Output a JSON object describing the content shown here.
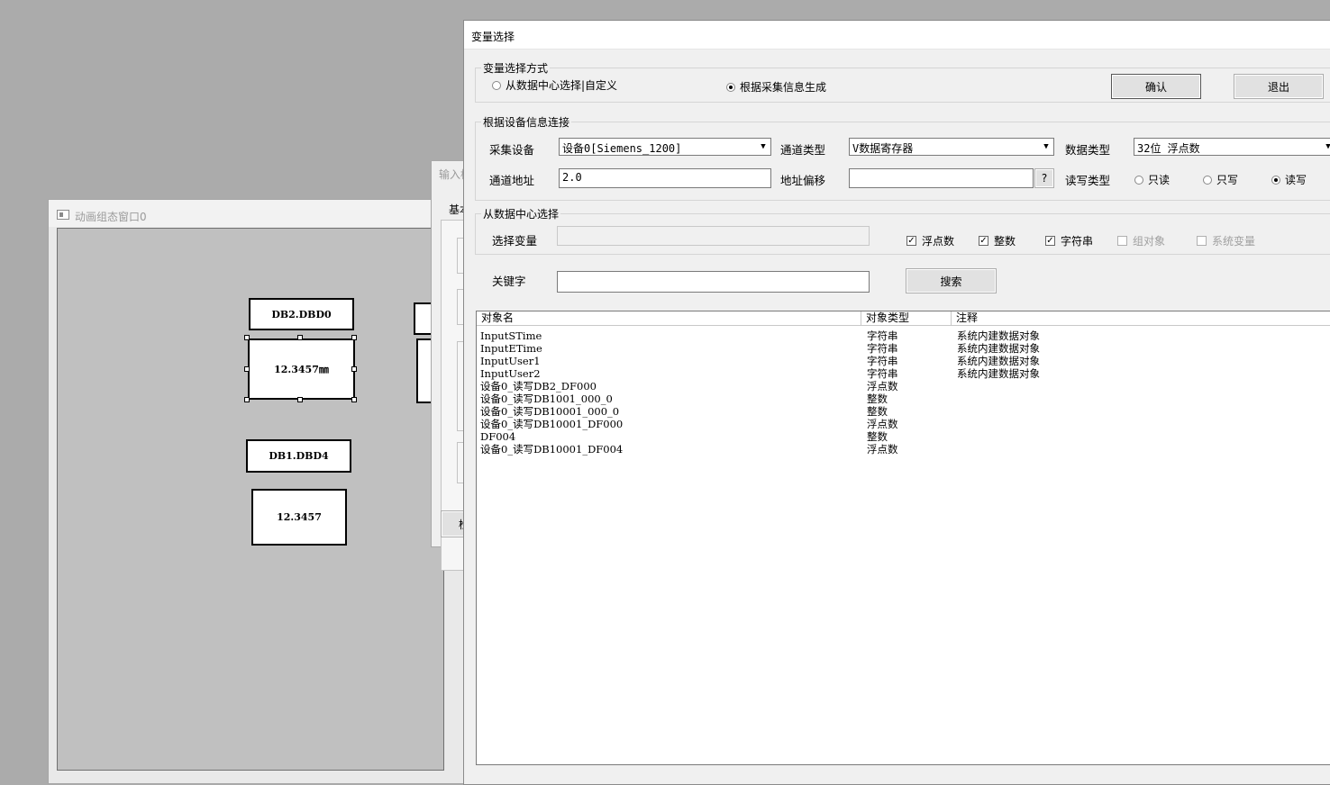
{
  "anim_window": {
    "title": "动画组态窗口0",
    "labels": [
      "DB2.DBD0",
      "DB1.DBD4"
    ],
    "values": [
      "12.3457㎜",
      "12.3457"
    ]
  },
  "mid_dialog": {
    "title": "输入框",
    "tab": "基本",
    "bottom_button": "检"
  },
  "dialog": {
    "title": "变量选择",
    "mode_group": {
      "legend": "变量选择方式",
      "opt_datacenter": "从数据中心选择|自定义",
      "opt_collect": "根据采集信息生成",
      "selected": "根据采集信息生成"
    },
    "confirm_label": "确认",
    "exit_label": "退出",
    "device_group": {
      "legend": "根据设备信息连接",
      "device_label": "采集设备",
      "device_value": "设备0[Siemens_1200]",
      "channel_type_label": "通道类型",
      "channel_type_value": "V数据寄存器",
      "data_type_label": "数据类型",
      "data_type_value": "32位 浮点数",
      "address_label": "通道地址",
      "address_value": "2.0",
      "offset_label": "地址偏移",
      "offset_value": "",
      "offset_btn": "?",
      "rw_label": "读写类型",
      "rw_readonly": "只读",
      "rw_writeonly": "只写",
      "rw_readwrite": "读写",
      "rw_selected": "读写"
    },
    "datacenter_group": {
      "legend": "从数据中心选择",
      "select_label": "选择变量",
      "select_value": "",
      "chk_float": "浮点数",
      "chk_int": "整数",
      "chk_string": "字符串",
      "chk_group": "组对象",
      "chk_system": "系统变量"
    },
    "keyword_label": "关键字",
    "keyword_value": "",
    "search_label": "搜索",
    "table": {
      "headers": [
        "对象名",
        "对象类型",
        "注释"
      ],
      "rows": [
        [
          "InputSTime",
          "字符串",
          "系统内建数据对象"
        ],
        [
          "InputETime",
          "字符串",
          "系统内建数据对象"
        ],
        [
          "InputUser1",
          "字符串",
          "系统内建数据对象"
        ],
        [
          "InputUser2",
          "字符串",
          "系统内建数据对象"
        ],
        [
          "设备0_读写DB2_DF000",
          "浮点数",
          ""
        ],
        [
          "设备0_读写DB1001_000_0",
          "整数",
          ""
        ],
        [
          "设备0_读写DB10001_000_0",
          "整数",
          ""
        ],
        [
          "设备0_读写DB10001_DF000",
          "浮点数",
          ""
        ],
        [
          "DF004",
          "整数",
          ""
        ],
        [
          "设备0_读写DB10001_DF004",
          "浮点数",
          ""
        ]
      ]
    }
  }
}
